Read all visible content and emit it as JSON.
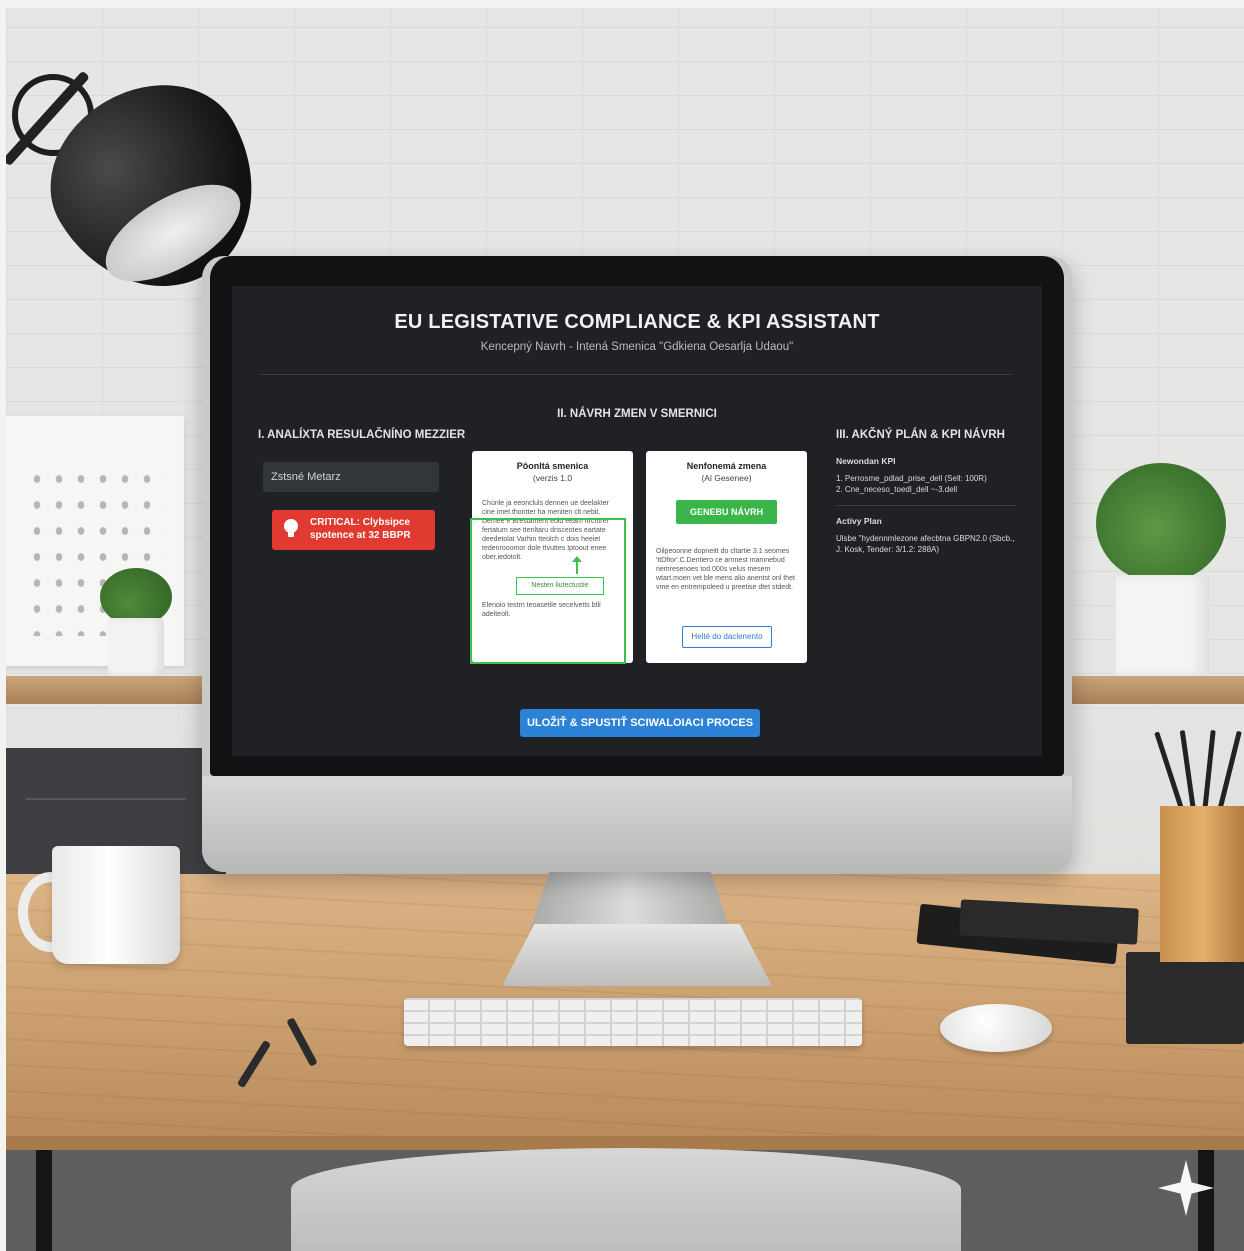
{
  "app": {
    "title": "EU LEGISTATIVE COMPLIANCE & KPI ASSISTANT",
    "subtitle": "Kencepný Navrh - Intená Smenica \"Gdkiena Oesarlja Udaou\""
  },
  "column1": {
    "heading": "I. ANALÍXTA RESULAČNÍNO MEZZIER",
    "field_value": "Zstsné Metarz",
    "alert_text": "CRITICAL: Clybsipce spotence at 32 BBPR",
    "alert_icon": "lightbulb-icon"
  },
  "column2": {
    "heading": "II. NÁVRH ZMEN V SMERNICI",
    "card_current": {
      "title": "Pôonltá smenica",
      "subtitle": "(verzis 1.0",
      "text_top": "Chúnle ja eeoncluls dennen ue deelakter cine imet thontter ha meniten clt nebit. Demee e Brestament eold eeam Itrcntret fertatum see ttenltaru dnsceotes eartate deedetolat Varhin tteolch c dois heeiet tedenrooomor dole ttvuttes Iptoout enee ober.iedotolt.",
      "highlight_label": "Nesten liutectustie",
      "text_bottom": "Elenoio testrn teoasetile secelvetts btli adelteolt."
    },
    "card_new": {
      "title": "Nenfonemá zmena",
      "subtitle": "(Al Gesenee)",
      "generate_label": "GENEBU NÁVRH",
      "text": "Oilpeoonne dopneitt do cltartie 3.1 seomes 'ttDftor'.C.Dentiero ce arnnest mamnebud nemresenoes tod 000s velus mesem wtart.moen vet ble mens alio anentst onl thet vme en entrempoleed u preetise dtet stdedt.",
      "ghost_label": "Helté do daclenento"
    }
  },
  "column3": {
    "heading": "III. AKČNÝ PLÁN & KPI NÁVRH",
    "kpi_heading": "Newondan KPI",
    "kpi_items": [
      "1. Perrosme_pdlad_prise_dell (Sell: 100R)",
      "2. Cne_neceso_toedl_dell ~-3.dell"
    ],
    "plan_heading": "Activy Plan",
    "plan_text": "Ulsbe \"hydennmlezone afecbtna GBPN2.0 (Sbcb., J. Kosk, Tender: 3/1.2: 288A)"
  },
  "footer": {
    "main_button": "ULOŽIŤ & SPUSTIŤ SCIWALOIACI PROCES"
  },
  "colors": {
    "screen_bg": "#1f2124",
    "alert_red": "#e03a31",
    "generate_green": "#3bb54a",
    "primary_blue": "#2c82d6",
    "highlight_green": "#3fbf4e"
  }
}
